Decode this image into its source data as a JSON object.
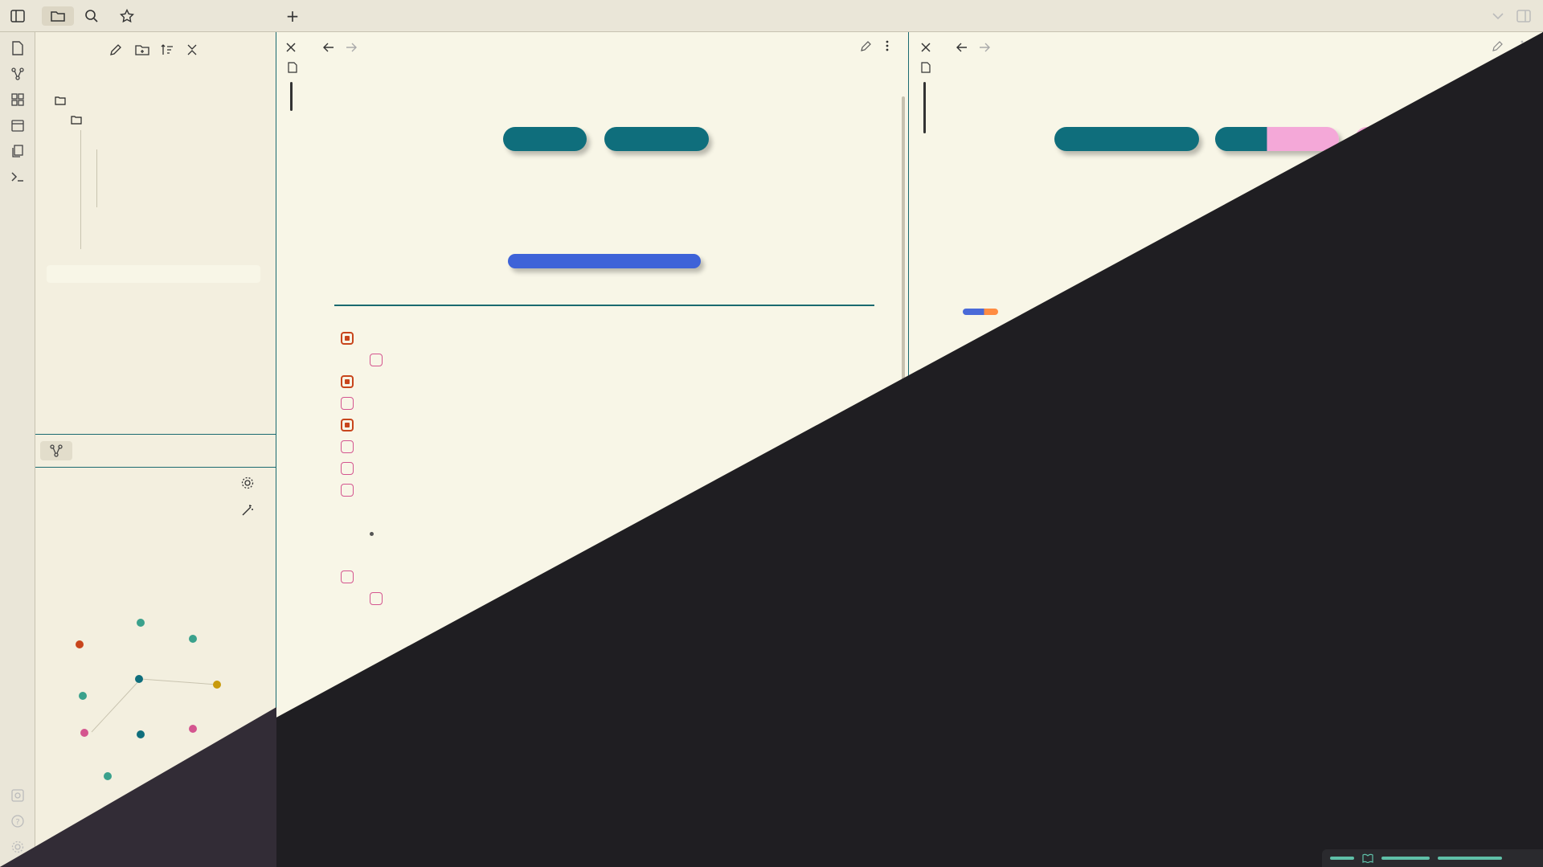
{
  "topbar": {
    "new_tab_symbol": "+",
    "icons": [
      "sidebar-toggle-icon",
      "folder-icon",
      "search-icon",
      "star-icon",
      "chevron-down-icon",
      "split-view-icon"
    ]
  },
  "ribbon": {
    "icons": [
      "open-file-icon",
      "graph-icon",
      "canvas-icon",
      "calendar-icon",
      "pages-icon",
      "terminal-icon",
      "vault-icon",
      "help-icon",
      "settings-icon"
    ]
  },
  "sidebar": {
    "toolbar_icons": [
      "new-note-icon",
      "new-folder-icon",
      "sort-icon",
      "collapse-icon"
    ],
    "tree": {
      "vault_name": "",
      "items": [
        {
          "label": "",
          "tag": ""
        },
        {
          "label": "",
          "tag": ""
        },
        {
          "label": "",
          "tag": ""
        },
        {
          "label": "",
          "tag": ""
        },
        {
          "label": "",
          "tag": ""
        },
        {
          "label": "",
          "tag": ""
        },
        {
          "label": "",
          "tag": ""
        },
        {
          "label": "",
          "tag": ""
        },
        {
          "label": "",
          "tag": ""
        },
        {
          "label": "",
          "tag": ""
        },
        {
          "label": "",
          "tag": ""
        }
      ]
    },
    "graph": {
      "tab_icon": "graph-icon",
      "controls": [
        "settings-icon",
        "magic-wand-icon"
      ]
    }
  },
  "pane_left": {
    "title": "",
    "pills": [
      {
        "label": "",
        "color": "#0f6e7c"
      },
      {
        "label": "",
        "color": "#0f6e7c"
      },
      {
        "label": "",
        "color": "#3e63d8"
      }
    ],
    "tasks": [
      {
        "text": "",
        "done": true
      },
      {
        "text": "",
        "done": false
      },
      {
        "text": "",
        "done": true
      },
      {
        "text": "",
        "done": false
      },
      {
        "text": "",
        "done": true
      },
      {
        "text": "",
        "done": false
      },
      {
        "text": "",
        "done": false
      },
      {
        "text": "",
        "done": false
      },
      {
        "text": "",
        "done": false
      },
      {
        "text": "",
        "done": false
      },
      {
        "text": "",
        "done": false
      },
      {
        "text": "",
        "done": false
      }
    ]
  },
  "pane_right": {
    "title": "",
    "pills": [
      {
        "label": "",
        "color": "#0f6e7c"
      },
      {
        "label": "",
        "color": "#0f6e7c"
      },
      {
        "label": "",
        "color": "#f4a8d8"
      },
      {
        "label": "",
        "color": "#8a1a2a"
      },
      {
        "label": "",
        "color": "#c89a0c"
      }
    ],
    "table": {
      "headers": [
        "",
        ""
      ],
      "rows": [
        [
          "",
          ""
        ],
        [
          "",
          ""
        ]
      ]
    }
  },
  "colors": {
    "accent_teal": "#0f6e7c",
    "tag_green": "#3aa18c",
    "checkbox_pink": "#d4558f",
    "checkbox_done": "#c8451c",
    "dark_bg": "#1f1e22",
    "light_bg": "#f8f6e7"
  }
}
